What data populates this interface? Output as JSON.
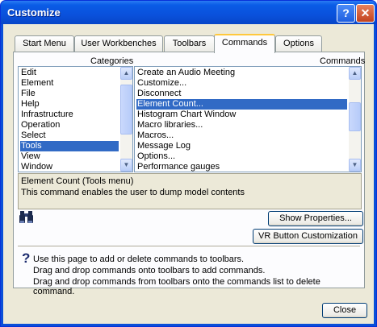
{
  "window": {
    "title": "Customize"
  },
  "tabs": [
    {
      "label": "Start Menu"
    },
    {
      "label": "User Workbenches"
    },
    {
      "label": "Toolbars"
    },
    {
      "label": "Commands"
    },
    {
      "label": "Options"
    }
  ],
  "active_tab": "Commands",
  "categories": {
    "label": "Categories",
    "items": [
      "Edit",
      "Element",
      "File",
      "Help",
      "Infrastructure",
      "Operation",
      "Select",
      "Tools",
      "View",
      "Window"
    ],
    "selected": "Tools"
  },
  "commands": {
    "label": "Commands",
    "items": [
      "Create an Audio Meeting",
      "Customize...",
      "Disconnect",
      "Element Count...",
      "Histogram Chart Window",
      "Macro libraries...",
      "Macros...",
      "Message Log",
      "Options...",
      "Performance gauges"
    ],
    "selected": "Element Count..."
  },
  "description": {
    "title": "Element Count (Tools menu)",
    "text": "This command enables the user to dump model contents"
  },
  "buttons": {
    "show_properties": "Show Properties...",
    "vr_customization": "VR Button Customization",
    "close": "Close"
  },
  "help": {
    "line1": "Use this page to add or delete commands to toolbars.",
    "line2": "Drag and drop commands onto toolbars to add commands.",
    "line3": "Drag and drop commands from toolbars onto the commands list to delete command."
  },
  "icons": {
    "title_help": "question-mark",
    "title_close": "x",
    "search": "binoculars-icon",
    "help": "question-icon"
  },
  "colors": {
    "titlebar": "#0a51dc",
    "selection": "#316ac5",
    "tab_highlight": "#ffc83c",
    "dialog_bg": "#ece9d8"
  }
}
